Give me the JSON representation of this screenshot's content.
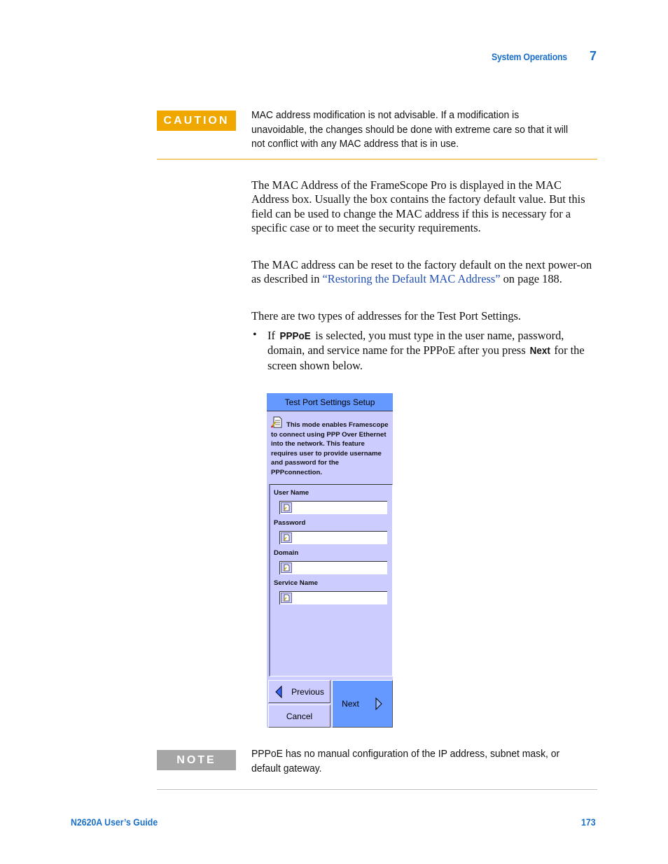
{
  "header": {
    "section": "System Operations",
    "chapter": "7"
  },
  "caution": {
    "label": "CAUTION",
    "text": "MAC address modification is not advisable. If a modification is unavoidable, the changes should be done with extreme care so that it will not conflict with any MAC address that is in use.",
    "color": "#f0a800"
  },
  "body": {
    "p1": "The MAC Address of the FrameScope Pro is displayed in the MAC Address box. Usually the box contains the factory default value. But this field can be used to change the MAC address if this is necessary for a specific case or to meet the security requirements.",
    "p2_before": "The MAC address can be reset to the factory default on the next power-on as described in ",
    "p2_link": "“Restoring the Default MAC Address”",
    "p2_after": " on page 188.",
    "p3": "There are two types of addresses for the Test Port Settings.",
    "bullet": {
      "symbol": "•",
      "t1": "If ",
      "k1": "PPPoE",
      "t2": " is selected, you must type in the user name, password, domain, and service name for the PPPoE after you press ",
      "k2": "Next",
      "t3": " for the screen shown below."
    }
  },
  "device": {
    "title": "Test Port Settings Setup",
    "info_icon": "document-edit-icon",
    "info_text": "This mode enables Framescope to connect using PPP Over Ethernet into the network. This feature requires user to provide username and password for the PPPconnection.",
    "fields": [
      {
        "label": "User Name",
        "value": ""
      },
      {
        "label": "Password",
        "value": ""
      },
      {
        "label": "Domain",
        "value": ""
      },
      {
        "label": "Service Name",
        "value": ""
      }
    ],
    "buttons": {
      "previous": "Previous",
      "cancel": "Cancel",
      "next": "Next"
    },
    "colors": {
      "title_bar": "#6699ff",
      "panel": "#ccccff"
    }
  },
  "note": {
    "label": "NOTE",
    "text": "PPPoE has no manual configuration of the IP address, subnet mask, or default gateway.",
    "color": "#a6a6a6"
  },
  "footer": {
    "guide": "N2620A User’s Guide",
    "page": "173"
  }
}
